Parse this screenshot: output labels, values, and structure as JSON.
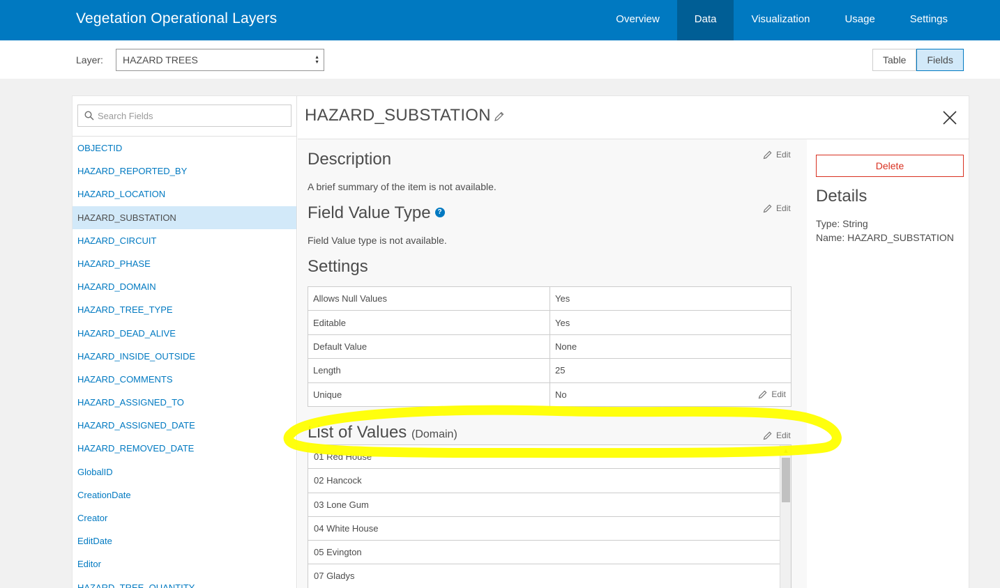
{
  "header": {
    "title": "Vegetation Operational Layers",
    "tabs": [
      {
        "label": "Overview"
      },
      {
        "label": "Data"
      },
      {
        "label": "Visualization"
      },
      {
        "label": "Usage"
      },
      {
        "label": "Settings"
      }
    ],
    "active_tab": "Data",
    "brand_color": "#0079c1"
  },
  "layerbar": {
    "label": "Layer:",
    "selected_layer": "HAZARD TREES",
    "view_buttons": [
      {
        "label": "Table"
      },
      {
        "label": "Fields"
      }
    ],
    "active_view": "Fields"
  },
  "sidebar": {
    "search_placeholder": "Search Fields",
    "fields": [
      "OBJECTID",
      "HAZARD_REPORTED_BY",
      "HAZARD_LOCATION",
      "HAZARD_SUBSTATION",
      "HAZARD_CIRCUIT",
      "HAZARD_PHASE",
      "HAZARD_DOMAIN",
      "HAZARD_TREE_TYPE",
      "HAZARD_DEAD_ALIVE",
      "HAZARD_INSIDE_OUTSIDE",
      "HAZARD_COMMENTS",
      "HAZARD_ASSIGNED_TO",
      "HAZARD_ASSIGNED_DATE",
      "HAZARD_REMOVED_DATE",
      "GlobalID",
      "CreationDate",
      "Creator",
      "EditDate",
      "Editor",
      "HAZARD_TREE_QUANTITY"
    ],
    "selected_field": "HAZARD_SUBSTATION"
  },
  "field": {
    "name": "HAZARD_SUBSTATION",
    "edit_label": "Edit",
    "description": {
      "title": "Description",
      "text": "A brief summary of the item is not available."
    },
    "value_type": {
      "title": "Field Value Type",
      "help": "?",
      "text": "Field Value type is not available."
    },
    "settings": {
      "title": "Settings",
      "rows": [
        {
          "name": "Allows Null Values",
          "value": "Yes"
        },
        {
          "name": "Editable",
          "value": "Yes"
        },
        {
          "name": "Default Value",
          "value": "None"
        },
        {
          "name": "Length",
          "value": "25"
        },
        {
          "name": "Unique",
          "value": "No"
        }
      ]
    },
    "domain": {
      "title": "List of Values",
      "subtitle": "(Domain)",
      "values": [
        "01 Red House",
        "02 Hancock",
        "03 Lone Gum",
        "04 White House",
        "05 Evington",
        "07 Gladys"
      ]
    }
  },
  "details": {
    "delete_label": "Delete",
    "title": "Details",
    "type_line": "Type: String",
    "name_line": "Name: HAZARD_SUBSTATION",
    "danger_color": "#d83020"
  },
  "annotation": {
    "color": "#ffff00"
  }
}
